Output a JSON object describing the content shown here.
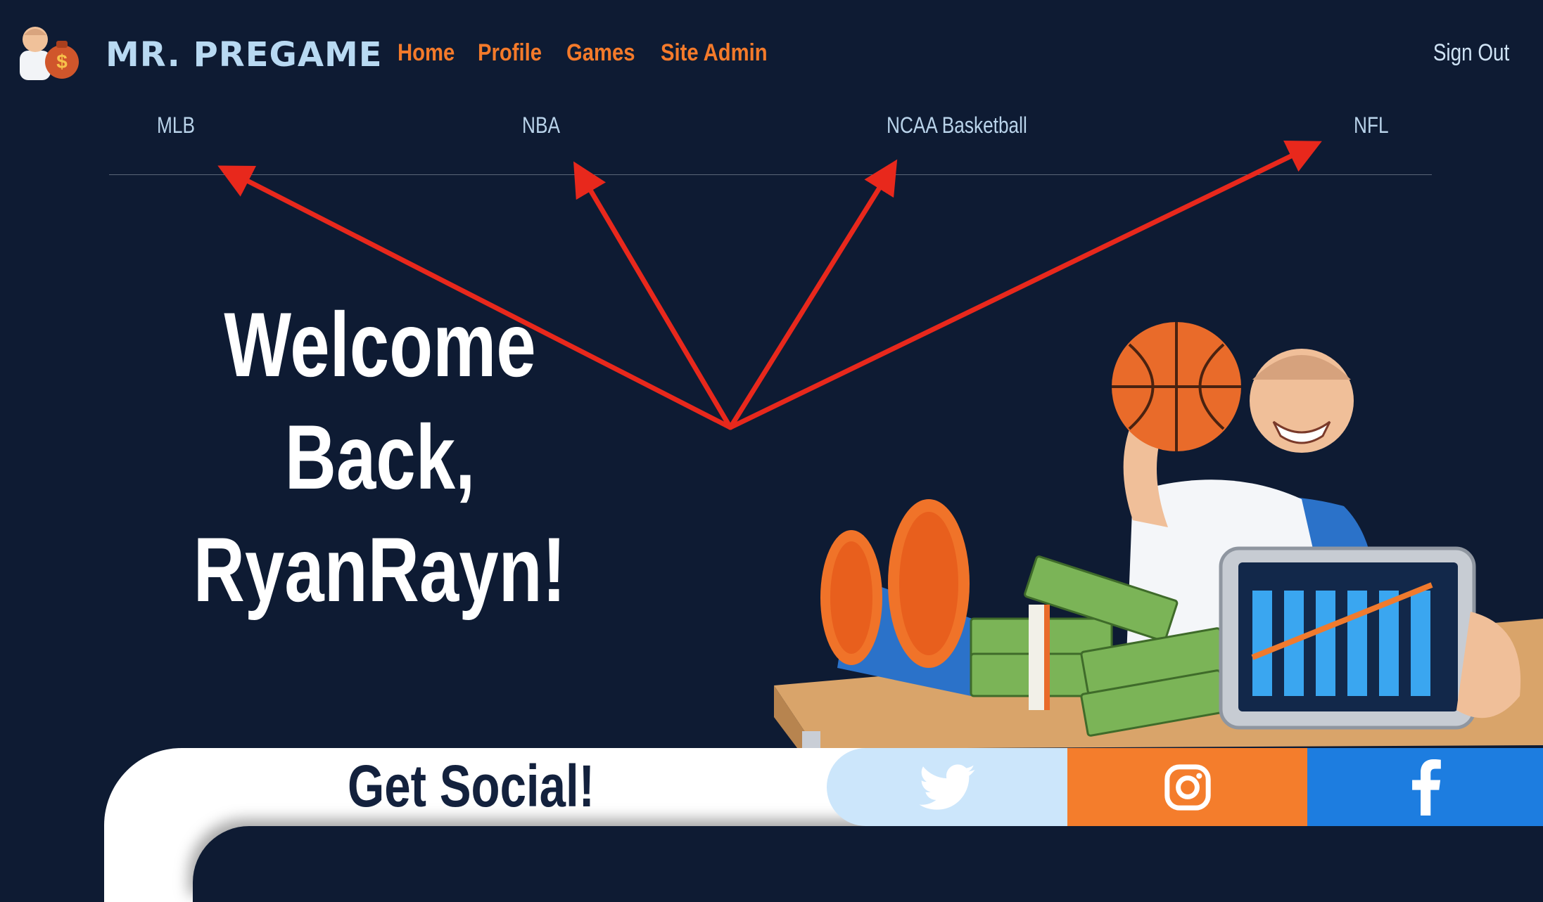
{
  "brand": {
    "name": "MR. PREGAME"
  },
  "nav": {
    "home": "Home",
    "profile": "Profile",
    "games": "Games",
    "site_admin": "Site Admin",
    "sign_out": "Sign Out"
  },
  "sports": [
    "MLB",
    "NBA",
    "NCAA Basketball",
    "NFL"
  ],
  "welcome": {
    "line1": "Welcome Back,",
    "line2": "RyanRayn!"
  },
  "social": {
    "title": "Get Social!",
    "links": [
      "twitter-icon",
      "instagram-icon",
      "facebook-icon"
    ]
  },
  "colors": {
    "background": "#0e1b33",
    "accent_orange": "#f47a2a",
    "brand_blue": "#b8d9f2",
    "annotation_red": "#e8281c",
    "twitter": "#cce6fb",
    "instagram": "#f47d2c",
    "facebook": "#1d7de0"
  }
}
